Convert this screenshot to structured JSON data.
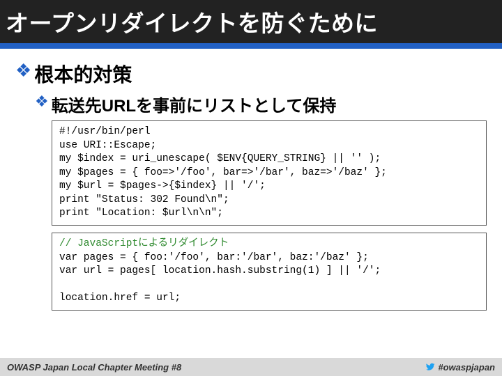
{
  "title": "オープンリダイレクトを防ぐために",
  "bullet1": "根本的対策",
  "bullet2": "転送先URLを事前にリストとして保持",
  "code1_lines": [
    "#!/usr/bin/perl",
    "use URI::Escape;",
    "my $index = uri_unescape( $ENV{QUERY_STRING} || '' );",
    "my $pages = { foo=>'/foo', bar=>'/bar', baz=>'/baz' };",
    "my $url = $pages->{$index} || '/';",
    "print \"Status: 302 Found\\n\";",
    "print \"Location: $url\\n\\n\";"
  ],
  "code2_comment": "// JavaScriptによるリダイレクト",
  "code2_lines": [
    "var pages = { foo:'/foo', bar:'/bar', baz:'/baz' };",
    "var url = pages[ location.hash.substring(1) ] || '/';",
    "",
    "location.href = url;"
  ],
  "footer_left": "OWASP Japan Local Chapter Meeting #8",
  "footer_right": "#owaspjapan"
}
